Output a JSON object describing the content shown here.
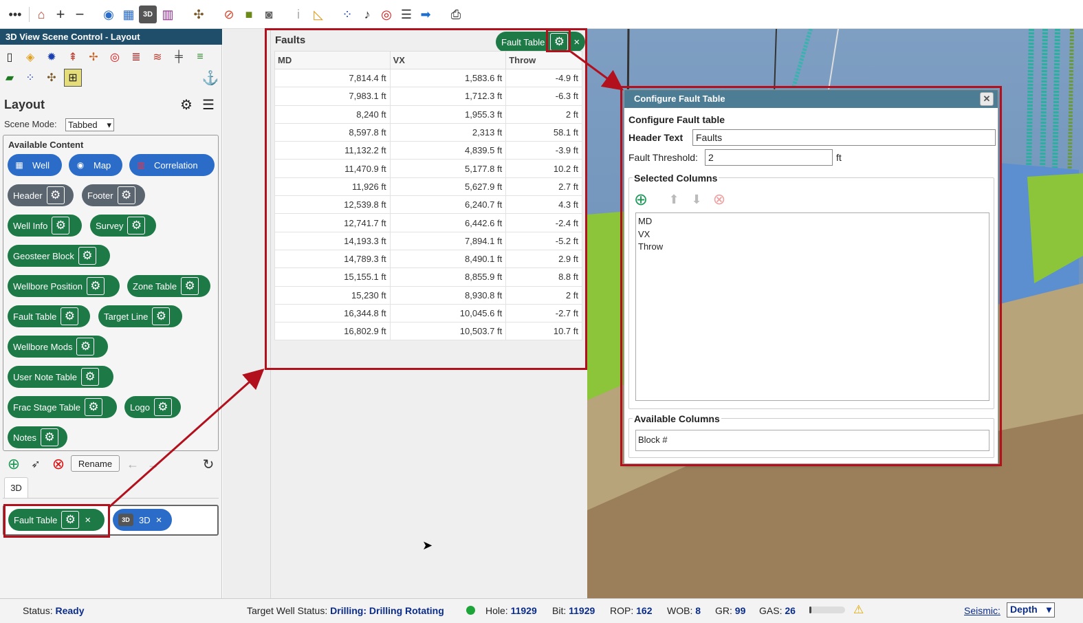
{
  "toolbar": {
    "icons": [
      "more-icon",
      "home-icon",
      "zoom-in-icon",
      "zoom-out-icon",
      "compass-icon",
      "well-icon",
      "3d-icon",
      "correlation-icon",
      "geosteer-icon",
      "no-signal-icon",
      "cube-icon",
      "camera-icon",
      "info-icon",
      "ruler-icon",
      "scatter-icon",
      "bell-icon",
      "target-icon",
      "lines-icon",
      "arrow-right-icon",
      "print-icon"
    ]
  },
  "left_panel": {
    "title": "3D View Scene Control - Layout",
    "layout_heading": "Layout",
    "scene_mode_label": "Scene Mode:",
    "scene_mode_value": "Tabbed",
    "available_content_label": "Available Content",
    "content_pills": [
      {
        "label": "Well",
        "color": "blue",
        "has_gear": false
      },
      {
        "label": "Map",
        "color": "blue",
        "has_gear": false
      },
      {
        "label": "Correlation",
        "color": "blue",
        "has_gear": false
      },
      {
        "label": "Header",
        "color": "gray",
        "has_gear": true
      },
      {
        "label": "Footer",
        "color": "gray",
        "has_gear": true
      },
      {
        "label": "Well Info",
        "color": "green",
        "has_gear": true
      },
      {
        "label": "Survey",
        "color": "green",
        "has_gear": true
      },
      {
        "label": "Geosteer Block",
        "color": "green",
        "has_gear": true
      },
      {
        "label": "Wellbore Position",
        "color": "green",
        "has_gear": true
      },
      {
        "label": "Zone Table",
        "color": "green",
        "has_gear": true
      },
      {
        "label": "Fault Table",
        "color": "green",
        "has_gear": true
      },
      {
        "label": "Target Line",
        "color": "green",
        "has_gear": true
      },
      {
        "label": "Wellbore Mods",
        "color": "green",
        "has_gear": true
      },
      {
        "label": "User Note Table",
        "color": "green",
        "has_gear": true
      },
      {
        "label": "Frac Stage Table",
        "color": "green",
        "has_gear": true
      },
      {
        "label": "Logo",
        "color": "green",
        "has_gear": true
      },
      {
        "label": "Notes",
        "color": "green",
        "has_gear": true
      }
    ],
    "rename_label": "Rename",
    "tab_label": "3D",
    "assigned": [
      {
        "label": "Fault Table",
        "icon": "gear-icon"
      },
      {
        "label": "3D",
        "icon": "3d-icon"
      }
    ]
  },
  "fault_panel": {
    "header": "Faults",
    "header_chip": "Fault Table",
    "columns": [
      "MD",
      "VX",
      "Throw"
    ],
    "rows": [
      [
        "7,814.4 ft",
        "1,583.6 ft",
        "-4.9 ft"
      ],
      [
        "7,983.1 ft",
        "1,712.3 ft",
        "-6.3 ft"
      ],
      [
        "8,240 ft",
        "1,955.3 ft",
        "2 ft"
      ],
      [
        "8,597.8 ft",
        "2,313 ft",
        "58.1 ft"
      ],
      [
        "11,132.2 ft",
        "4,839.5 ft",
        "-3.9 ft"
      ],
      [
        "11,470.9 ft",
        "5,177.8 ft",
        "10.2 ft"
      ],
      [
        "11,926 ft",
        "5,627.9 ft",
        "2.7 ft"
      ],
      [
        "12,539.8 ft",
        "6,240.7 ft",
        "4.3 ft"
      ],
      [
        "12,741.7 ft",
        "6,442.6 ft",
        "-2.4 ft"
      ],
      [
        "14,193.3 ft",
        "7,894.1 ft",
        "-5.2 ft"
      ],
      [
        "14,789.3 ft",
        "8,490.1 ft",
        "2.9 ft"
      ],
      [
        "15,155.1 ft",
        "8,855.9 ft",
        "8.8 ft"
      ],
      [
        "15,230 ft",
        "8,930.8 ft",
        "2 ft"
      ],
      [
        "16,344.8 ft",
        "10,045.6 ft",
        "-2.7 ft"
      ],
      [
        "16,802.9 ft",
        "10,503.7 ft",
        "10.7 ft"
      ]
    ]
  },
  "dialog": {
    "title": "Configure Fault Table",
    "subtitle": "Configure Fault table",
    "header_text_label": "Header Text",
    "header_text_value": "Faults",
    "threshold_label": "Fault Threshold:",
    "threshold_value": "2",
    "threshold_unit": "ft",
    "selected_columns_label": "Selected Columns",
    "selected_columns": [
      "MD",
      "VX",
      "Throw"
    ],
    "available_columns_label": "Available Columns",
    "available_columns": [
      "Block #"
    ]
  },
  "status_bar": {
    "status_label": "Status:",
    "status_value": "Ready",
    "target_label": "Target Well Status:",
    "target_value": "Drilling: Drilling Rotating",
    "hole_label": "Hole:",
    "hole_value": "11929",
    "bit_label": "Bit:",
    "bit_value": "11929",
    "rop_label": "ROP:",
    "rop_value": "162",
    "wob_label": "WOB:",
    "wob_value": "8",
    "gr_label": "GR:",
    "gr_value": "99",
    "gas_label": "GAS:",
    "gas_value": "26",
    "seismic_label": "Seismic:",
    "seismic_value": "Depth"
  }
}
